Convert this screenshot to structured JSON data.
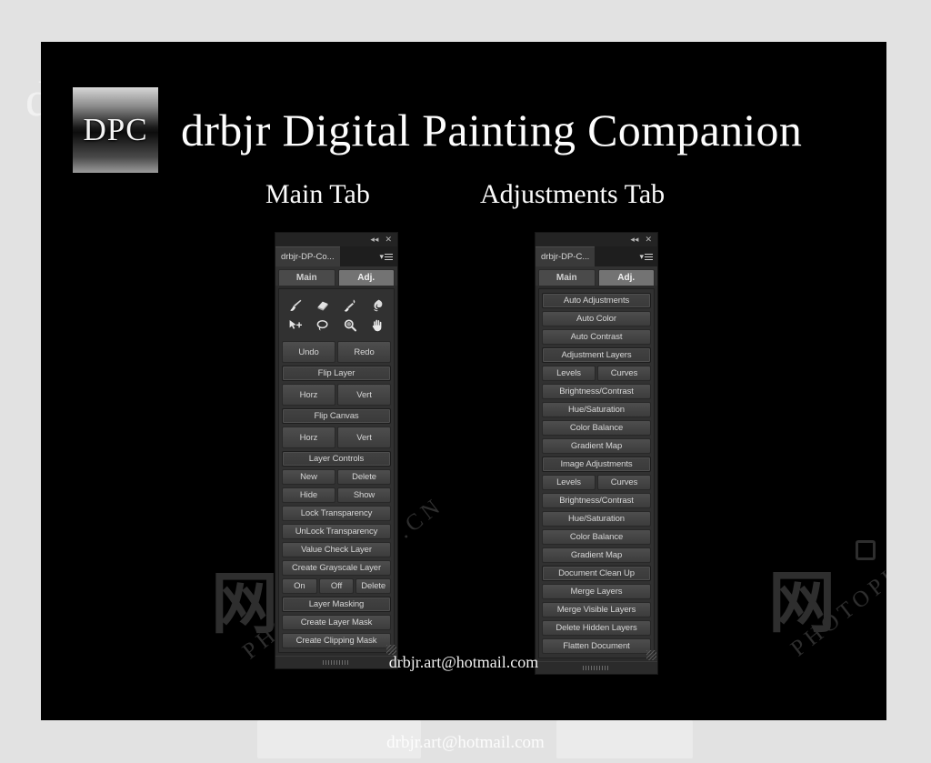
{
  "app": {
    "logo_text": "DPC",
    "title": "drbjr Digital Painting Companion",
    "email": "drbjr.art@hotmail.com"
  },
  "captions": {
    "main": "Main Tab",
    "adjustments": "Adjustments Tab"
  },
  "watermark": {
    "cjk": "网",
    "site": "PHOTOPHOTO.CN"
  },
  "panel_main": {
    "tab_name": "drbjr-DP-Co...",
    "collapse_icon": "◂◂",
    "close_icon": "✕",
    "menu_icon": "▾",
    "tabs": [
      {
        "label": "Main",
        "active": false
      },
      {
        "label": "Adj.",
        "active": true
      }
    ],
    "tools": [
      {
        "name": "brush-tool-icon"
      },
      {
        "name": "eraser-tool-icon"
      },
      {
        "name": "mixer-brush-tool-icon"
      },
      {
        "name": "smudge-tool-icon"
      },
      {
        "name": "move-tool-icon"
      },
      {
        "name": "lasso-tool-icon"
      },
      {
        "name": "zoom-tool-icon"
      },
      {
        "name": "hand-tool-icon"
      }
    ],
    "groups": [
      {
        "type": "row",
        "buttons": [
          "Undo",
          "Redo"
        ],
        "tall": true
      },
      {
        "type": "header",
        "buttons": [
          "Flip Layer"
        ]
      },
      {
        "type": "row",
        "buttons": [
          "Horz",
          "Vert"
        ],
        "tall": true
      },
      {
        "type": "header",
        "buttons": [
          "Flip Canvas"
        ]
      },
      {
        "type": "row",
        "buttons": [
          "Horz",
          "Vert"
        ],
        "tall": true
      },
      {
        "type": "header",
        "buttons": [
          "Layer Controls"
        ]
      },
      {
        "type": "row",
        "buttons": [
          "New",
          "Delete"
        ]
      },
      {
        "type": "row",
        "buttons": [
          "Hide",
          "Show"
        ]
      },
      {
        "type": "full",
        "buttons": [
          "Lock Transparency"
        ]
      },
      {
        "type": "full",
        "buttons": [
          "UnLock Transparency"
        ]
      },
      {
        "type": "full",
        "buttons": [
          "Value Check Layer"
        ]
      },
      {
        "type": "full",
        "buttons": [
          "Create Grayscale Layer"
        ]
      },
      {
        "type": "row",
        "buttons": [
          "On",
          "Off",
          "Delete"
        ]
      },
      {
        "type": "header",
        "buttons": [
          "Layer Masking"
        ]
      },
      {
        "type": "full",
        "buttons": [
          "Create Layer Mask"
        ]
      },
      {
        "type": "full",
        "buttons": [
          "Create Clipping Mask"
        ]
      }
    ]
  },
  "panel_adj": {
    "tab_name": "drbjr-DP-C...",
    "collapse_icon": "◂◂",
    "close_icon": "✕",
    "menu_icon": "▾",
    "tabs": [
      {
        "label": "Main",
        "active": false
      },
      {
        "label": "Adj.",
        "active": true
      }
    ],
    "groups": [
      {
        "type": "header",
        "buttons": [
          "Auto Adjustments"
        ]
      },
      {
        "type": "full",
        "buttons": [
          "Auto Color"
        ]
      },
      {
        "type": "full",
        "buttons": [
          "Auto Contrast"
        ]
      },
      {
        "type": "header",
        "buttons": [
          "Adjustment Layers"
        ]
      },
      {
        "type": "row",
        "buttons": [
          "Levels",
          "Curves"
        ]
      },
      {
        "type": "full",
        "buttons": [
          "Brightness/Contrast"
        ]
      },
      {
        "type": "full",
        "buttons": [
          "Hue/Saturation"
        ]
      },
      {
        "type": "full",
        "buttons": [
          "Color Balance"
        ]
      },
      {
        "type": "full",
        "buttons": [
          "Gradient Map"
        ]
      },
      {
        "type": "header",
        "buttons": [
          "Image Adjustments"
        ]
      },
      {
        "type": "row",
        "buttons": [
          "Levels",
          "Curves"
        ]
      },
      {
        "type": "full",
        "buttons": [
          "Brightness/Contrast"
        ]
      },
      {
        "type": "full",
        "buttons": [
          "Hue/Saturation"
        ]
      },
      {
        "type": "full",
        "buttons": [
          "Color Balance"
        ]
      },
      {
        "type": "full",
        "buttons": [
          "Gradient Map"
        ]
      },
      {
        "type": "header",
        "buttons": [
          "Document Clean Up"
        ]
      },
      {
        "type": "full",
        "buttons": [
          "Merge Layers"
        ]
      },
      {
        "type": "full",
        "buttons": [
          "Merge Visible Layers"
        ]
      },
      {
        "type": "full",
        "buttons": [
          "Delete Hidden Layers"
        ]
      },
      {
        "type": "full",
        "buttons": [
          "Flatten Document"
        ]
      }
    ]
  },
  "colors": {
    "page_background": "#e2e2e2",
    "card_background": "#000000",
    "panel_background": "#313131",
    "button_face": "#454545",
    "text": "#d6d6d6",
    "active_tab": "#737373"
  }
}
